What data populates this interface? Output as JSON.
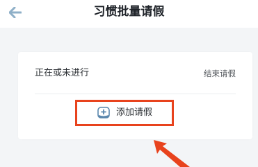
{
  "header": {
    "title": "习惯批量请假",
    "back_icon": "arrow-left-icon"
  },
  "card": {
    "status_label": "正在或未进行",
    "end_link_label": "结束请假",
    "add_button_label": "添加请假",
    "add_icon": "add-leave-icon"
  },
  "colors": {
    "highlight": "#e8431d",
    "back_icon": "#8fb0c8",
    "add_icon": "#5a87ad"
  }
}
